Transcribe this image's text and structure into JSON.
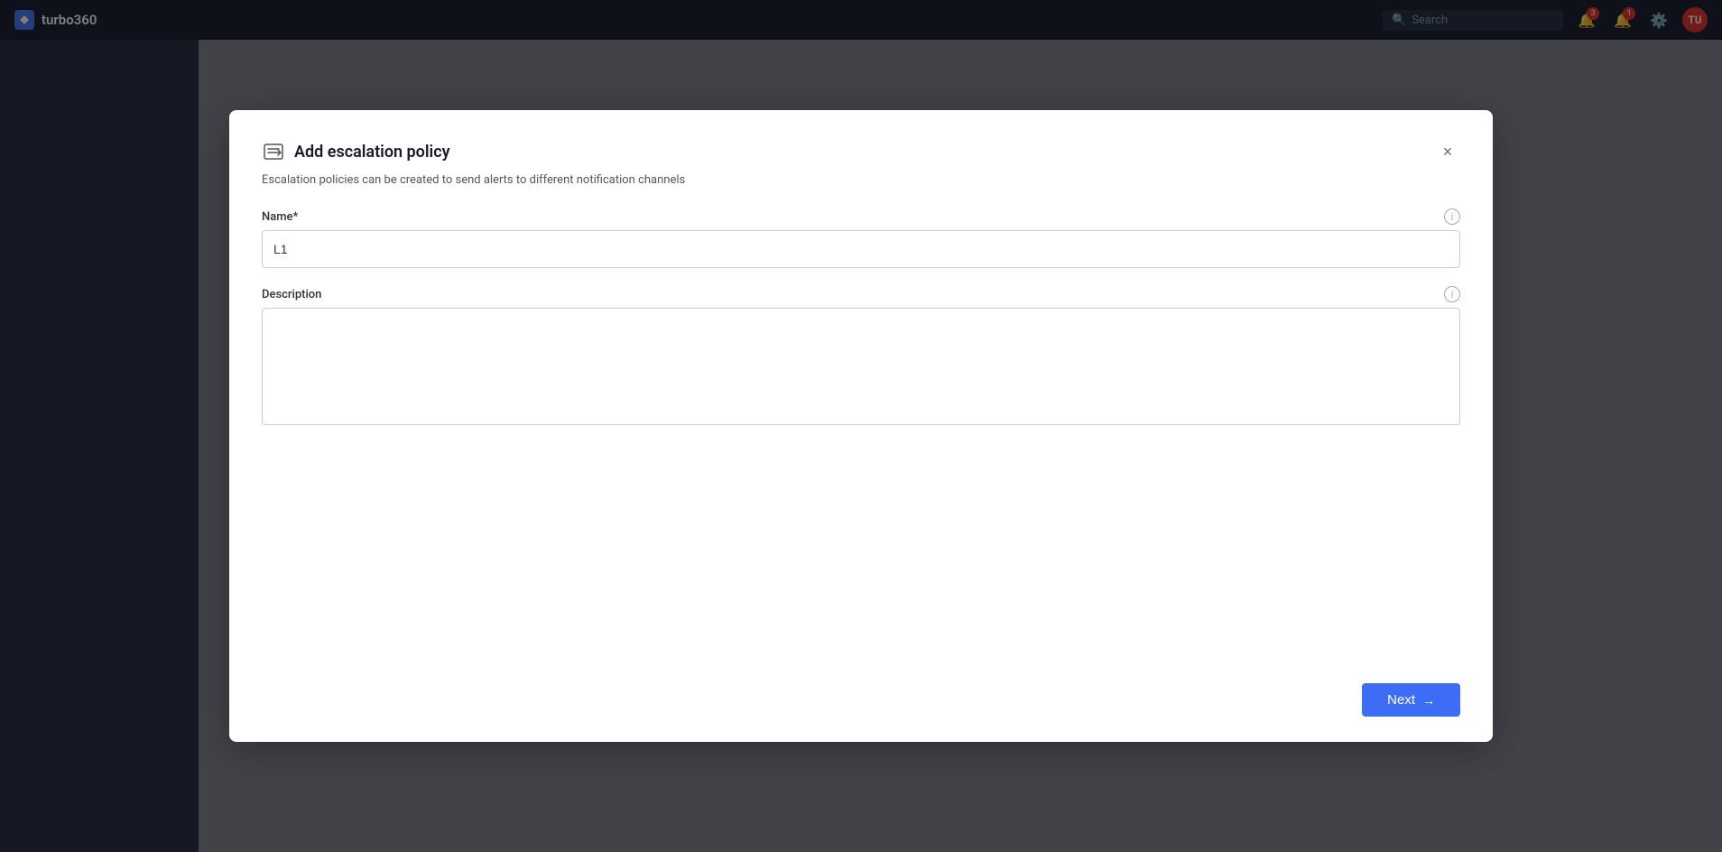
{
  "topbar": {
    "logo_text": "turbo360",
    "search_placeholder": "Search",
    "nav_icon_notifications_count": "3",
    "nav_icon_alerts_count": "1",
    "avatar_initials": "TU"
  },
  "modal": {
    "title": "Add escalation policy",
    "subtitle": "Escalation policies can be created to send alerts to different notification channels",
    "close_label": "×",
    "form": {
      "name_label": "Name*",
      "name_value": "L1",
      "name_placeholder": "",
      "description_label": "Description",
      "description_value": "",
      "description_placeholder": ""
    },
    "footer": {
      "next_button_label": "Next",
      "next_arrow": "→"
    }
  }
}
